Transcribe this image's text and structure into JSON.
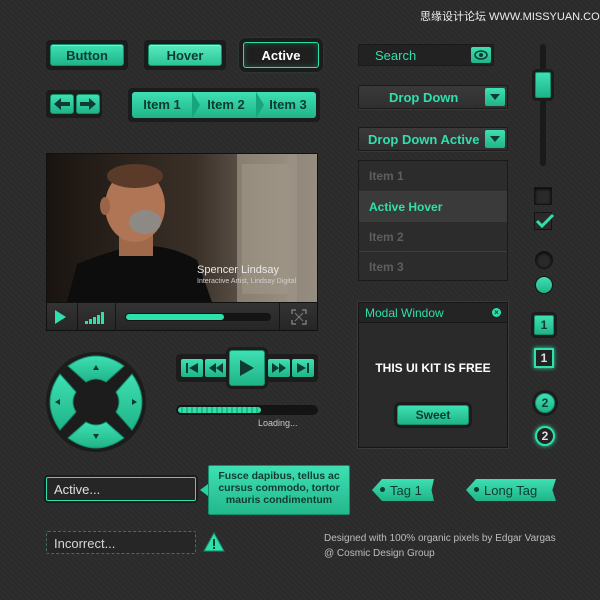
{
  "watermark": "思缘设计论坛  WWW.MISSYUAN.COM",
  "buttons": {
    "button": "Button",
    "hover": "Hover",
    "active": "Active"
  },
  "breadcrumb": [
    "Item 1",
    "Item 2",
    "Item 3"
  ],
  "search": {
    "placeholder": "Search"
  },
  "dropdown": {
    "label": "Drop Down"
  },
  "dropdown_active": {
    "label": "Drop Down Active",
    "items": [
      "Item 1",
      "Active Hover",
      "Item 2",
      "Item 3"
    ]
  },
  "video": {
    "person": "Spencer Lindsay",
    "role": "Interactive Artist, Lindsay Digital",
    "progress": 0.68
  },
  "loading": {
    "label": "Loading...",
    "progress": 0.6
  },
  "modal": {
    "title": "Modal Window",
    "body": "THIS UI KIT IS FREE",
    "button": "Sweet"
  },
  "inputs": {
    "active_value": "Active...",
    "incorrect_value": "Incorrect..."
  },
  "tooltip": "Fusce dapibus, tellus ac cursus commodo, tortor mauris condimentum",
  "tags": [
    "Tag 1",
    "Long Tag"
  ],
  "pagination": [
    "1",
    "1",
    "2",
    "2"
  ],
  "credits": {
    "line1": "Designed with 100% organic pixels by Edgar Vargas",
    "line2": "@ Cosmic Design Group"
  },
  "colors": {
    "accent": "#2ee0ab",
    "dark": "#1c1c1c",
    "background": "#2b2b2b"
  }
}
